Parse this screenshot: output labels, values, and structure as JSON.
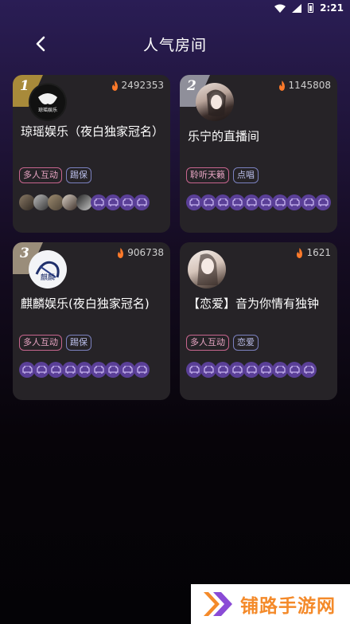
{
  "status_bar": {
    "time": "2:21"
  },
  "header": {
    "title": "人气房间"
  },
  "rooms": [
    {
      "rank": "1",
      "heat": "2492353",
      "name": "琼瑶娱乐（夜白独家冠名）",
      "avatar_label": "琼瑶娱乐",
      "tags": [
        "多人互动",
        "踢保"
      ],
      "rank_color": "#a88a3a"
    },
    {
      "rank": "2",
      "heat": "1145808",
      "name": "乐宁的直播间",
      "tags": [
        "聆听天籁",
        "点唱"
      ],
      "rank_color": "#8f8f9a"
    },
    {
      "rank": "3",
      "heat": "906738",
      "name": "麒麟娱乐(夜白独家冠名)",
      "avatar_label": "麒麟",
      "tags": [
        "多人互动",
        "踢保"
      ],
      "rank_color": "#9a8d7a"
    },
    {
      "rank": "",
      "heat": "1621",
      "name": "【恋爱】音为你情有独钟",
      "tags": [
        "多人互动",
        "恋爱"
      ],
      "rank_color": ""
    }
  ],
  "watermark": {
    "text": "铺路手游网"
  },
  "colors": {
    "seat_purple": "#5a3f97",
    "fire_orange": "#ff7a2a",
    "brand_orange": "#f48a2a"
  }
}
